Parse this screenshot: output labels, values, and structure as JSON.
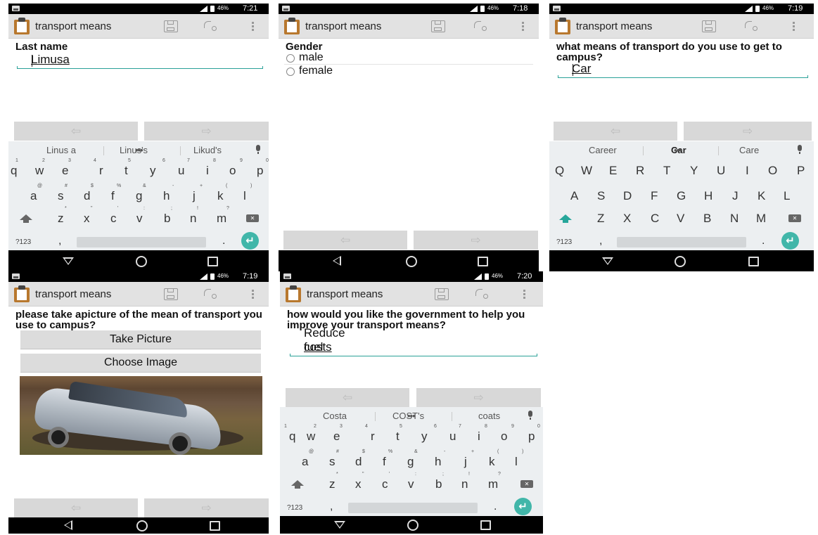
{
  "status": {
    "battery": "46%",
    "times": [
      "7:21",
      "7:18",
      "7:19",
      "7:19",
      "7:20"
    ]
  },
  "app": {
    "title": "transport means"
  },
  "screens": {
    "last_name": {
      "question": "Last name",
      "value": "Limusa"
    },
    "gender": {
      "question": "Gender",
      "options": [
        "male",
        "female"
      ]
    },
    "transport": {
      "question": "what means of transport do you use to get to campus?",
      "value": "Car"
    },
    "picture": {
      "question": "please take apicture of the mean of transport you use to campus?",
      "take_label": "Take Picture",
      "choose_label": "Choose Image"
    },
    "government": {
      "question": "how would you like the government to help you improve your transport means?",
      "value_plain": "Reduce fuel ",
      "value_underlined": "costs"
    }
  },
  "nav": {
    "prev": "⇦",
    "next": "⇨"
  },
  "keyboard": {
    "suggestions_1": [
      "Linus a",
      "Linus's",
      "Likud's"
    ],
    "suggestions_3": [
      "Career",
      "Car",
      "Care"
    ],
    "suggestions_5": [
      "Costa",
      "COST's",
      "coats"
    ],
    "row1": [
      "q",
      "w",
      "e",
      "r",
      "t",
      "y",
      "u",
      "i",
      "o",
      "p"
    ],
    "row1_upper": [
      "Q",
      "W",
      "E",
      "R",
      "T",
      "Y",
      "U",
      "I",
      "O",
      "P"
    ],
    "row1_hints": [
      "1",
      "2",
      "3",
      "4",
      "5",
      "6",
      "7",
      "8",
      "9",
      "0"
    ],
    "row2": [
      "a",
      "s",
      "d",
      "f",
      "g",
      "h",
      "j",
      "k",
      "l"
    ],
    "row2_upper": [
      "A",
      "S",
      "D",
      "F",
      "G",
      "H",
      "J",
      "K",
      "L"
    ],
    "row2_hints": [
      "@",
      "#",
      "$",
      "%",
      "&",
      "-",
      "+",
      "(",
      ")"
    ],
    "row3": [
      "z",
      "x",
      "c",
      "v",
      "b",
      "n",
      "m"
    ],
    "row3_upper": [
      "Z",
      "X",
      "C",
      "V",
      "B",
      "N",
      "M"
    ],
    "row3_hints": [
      "*",
      "\"",
      "'",
      ":",
      ";",
      "!",
      "?"
    ],
    "sym_label": "?123",
    "comma": ",",
    "period": ".",
    "enter": "↵",
    "delete": "✕"
  },
  "icons": [
    "image-icon",
    "signal-icon",
    "battery-icon",
    "clipboard-icon",
    "save-icon",
    "route-icon",
    "overflow-menu-icon",
    "back-icon",
    "home-icon",
    "recent-apps-icon",
    "hide-keyboard-icon",
    "shift-icon",
    "delete-icon",
    "mic-icon",
    "enter-icon"
  ],
  "colors": {
    "accent": "#26a69a",
    "appbar": "#e2e2e2",
    "keyboard": "#eceff1"
  }
}
